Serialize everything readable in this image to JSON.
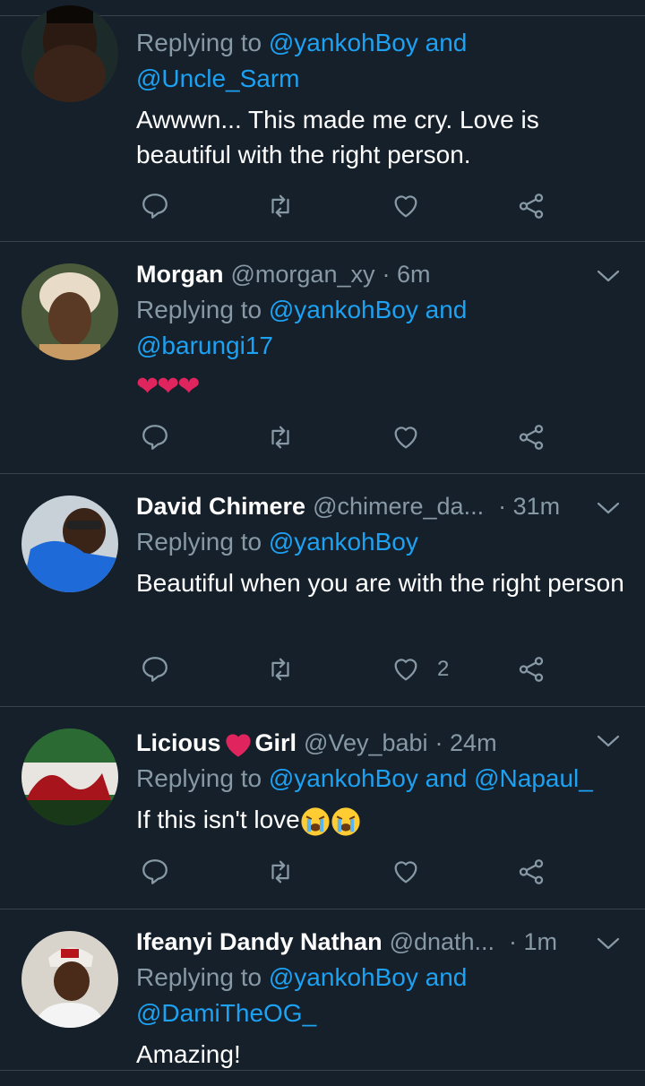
{
  "tweets": [
    {
      "id": "t0",
      "name": "",
      "handle": "",
      "time": "",
      "replying_prefix": "Replying to ",
      "reply_line1": "@yankohBoy and",
      "reply_line2": "@Uncle_Sarm",
      "body": "Awwwn... This made me cry. Love is beautiful with the right person.",
      "likes": ""
    },
    {
      "id": "t1",
      "name": "Morgan",
      "handle": "@morgan_xy",
      "time": "· 6m",
      "replying_prefix": "Replying to ",
      "reply_line1": "@yankohBoy and",
      "reply_line2": "@barungi17",
      "body": "❤❤❤",
      "likes": ""
    },
    {
      "id": "t2",
      "name": "David Chimere",
      "handle": "@chimere_da...",
      "time": "· 31m",
      "replying_prefix": "Replying to ",
      "reply_line1": "@yankohBoy",
      "reply_line2": "",
      "body": "Beautiful when you are with the right person",
      "likes": "2"
    },
    {
      "id": "t3",
      "name_part1": "Licious",
      "name_part2": "Girl",
      "handle": "@Vey_babi",
      "time": "· 24m",
      "replying_prefix": "Replying to ",
      "reply_line1": "@yankohBoy and @Napaul_",
      "body": "If this isn't love",
      "likes": ""
    },
    {
      "id": "t4",
      "name": "Ifeanyi Dandy Nathan",
      "handle": "@dnath...",
      "time": "· 1m",
      "replying_prefix": "Replying to ",
      "reply_line1": "@yankohBoy and",
      "reply_line2": "@DamiTheOG_",
      "body": "Amazing!",
      "likes": ""
    }
  ],
  "icons": {
    "reply": "reply-icon",
    "retweet": "retweet-icon",
    "like": "heart-icon",
    "share": "share-icon",
    "more": "chevron-down-icon"
  },
  "colors": {
    "background": "#15202b",
    "divider": "#38444d",
    "secondary_text": "#8899a6",
    "mention": "#1da1f2",
    "emoji_heart": "#e0245e"
  }
}
